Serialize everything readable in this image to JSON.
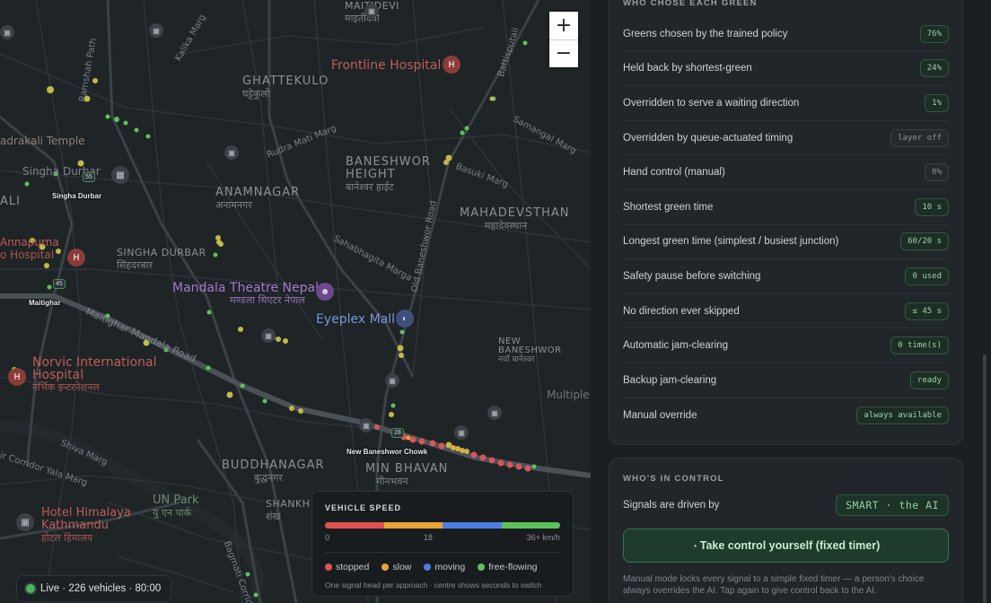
{
  "map": {
    "places": [
      {
        "id": "ghattekulo",
        "name": "GHATTEKULO",
        "local": "घट्टेकुलो"
      },
      {
        "id": "anamnagar",
        "name": "ANAMNAGAR",
        "local": "अनामनगर"
      },
      {
        "id": "baneshwor-height",
        "name": "BANESHWOR HEIGHT",
        "local": "बानेश्वर हाईट"
      },
      {
        "id": "mahadevsthan",
        "name": "MAHADEVSTHAN",
        "local": "महादेवस्थान"
      },
      {
        "id": "singha-durbar",
        "name": "SINGHA DURBAR",
        "local": "सिंहदरबार"
      },
      {
        "id": "buddhanagar",
        "name": "BUDDHANAGAR",
        "local": "बुद्धनगर"
      },
      {
        "id": "min-bhavan",
        "name": "MIN BHAVAN",
        "local": "मीनभवन"
      },
      {
        "id": "new-baneshwor",
        "name": "NEW BANESHWOR",
        "local": "नयाँ बानेश्वर"
      },
      {
        "id": "maitidevi",
        "name": "MAITIDEVI",
        "local": "माइतीदेवी"
      },
      {
        "id": "shankh",
        "name": "SHANKH",
        "local": "शंख"
      }
    ],
    "landmarks": {
      "frontline": "Frontline Hospital",
      "mandala": "Mandala Theatre Nepal",
      "mandala_local": "मण्डला थिएटर नेपाल",
      "eyeplex": "Eyeplex Mall",
      "norvic": "Norvic International Hospital",
      "norvic_local": "नर्भिक इन्टरनेशनल",
      "bhadrakali": "adrakali Temple",
      "singha_durbar_poi": "Singha Durbar",
      "annapurna": "Annapurna",
      "hospital_fragment": "o Hospital",
      "himalaya": "Hotel Himalaya Kathmandu",
      "himalaya_local": "होटल हिमालय",
      "un_park": "UN Park",
      "un_park_local": "यु एन पार्क",
      "multiple": "Multiple"
    },
    "roads": {
      "ramshah": "Ramshah Path",
      "kalika": "Kalika Marg",
      "batisputali": "Battisputali",
      "samangal": "Samangal Marg",
      "rudra": "Rudra Mati Marg",
      "basuki": "Basuki Marg",
      "old_baneshwor": "Old Baneshwor Road",
      "sahabhagita": "Sahabhagita Marga",
      "maitighar_mandala": "Maitighar Mandala Road",
      "shiva": "Shiva Marg",
      "corridor": "ir Corridor Yala Marg",
      "bagmati": "Bagmati Corridor",
      "ali": "ALI"
    },
    "junctions": {
      "singha": {
        "label": "Singha Durbar",
        "seconds": "55"
      },
      "maitighar": {
        "label": "Maitighar",
        "seconds": "45"
      },
      "new_baneshwor": {
        "label": "New Baneshwor Chowk",
        "seconds": "28"
      }
    },
    "zoom_in": "+",
    "zoom_out": "−"
  },
  "speed_legend": {
    "title": "VEHICLE SPEED",
    "ticks": [
      "0",
      "18",
      "36+ km/h"
    ],
    "colors": [
      "#e05252",
      "#e8a63a",
      "#4f7fe0",
      "#5ec25c"
    ],
    "items": [
      {
        "label": "stopped",
        "color": "#e05252"
      },
      {
        "label": "slow",
        "color": "#e8a63a"
      },
      {
        "label": "moving",
        "color": "#4f7fe0"
      },
      {
        "label": "free-flowing",
        "color": "#5ec25c"
      }
    ],
    "note": "One signal head per approach · centre shows seconds to switch"
  },
  "live": "Live · 226 vehicles · 80:00",
  "panel": {
    "greens_title": "WHO CHOSE EACH GREEN",
    "rows": [
      {
        "label": "Greens chosen by the trained policy",
        "value": "76%",
        "state": "on"
      },
      {
        "label": "Held back by shortest-green",
        "value": "24%",
        "state": "on"
      },
      {
        "label": "Overridden to serve a waiting direction",
        "value": "1%",
        "state": "on"
      },
      {
        "label": "Overridden by queue-actuated timing",
        "value": "layer off",
        "state": "off"
      },
      {
        "label": "Hand control (manual)",
        "value": "0%",
        "state": "off"
      },
      {
        "label": "Shortest green time",
        "value": "10 s",
        "state": "on"
      },
      {
        "label": "Longest green time (simplest / busiest junction)",
        "value": "60/20 s",
        "state": "on"
      },
      {
        "label": "Safety pause before switching",
        "value": "0 used",
        "state": "on"
      },
      {
        "label": "No direction ever skipped",
        "value": "≤ 45 s",
        "state": "on"
      },
      {
        "label": "Automatic jam-clearing",
        "value": "0 time(s)",
        "state": "on"
      },
      {
        "label": "Backup jam-clearing",
        "value": "ready",
        "state": "on"
      },
      {
        "label": "Manual override",
        "value": "always available",
        "state": "on"
      }
    ],
    "control_title": "WHO'S IN CONTROL",
    "driven_label": "Signals are driven by",
    "driven_value": "SMART · the AI",
    "take_icon": "◔",
    "take_label": "Take control yourself (fixed timer)",
    "manual_note": "Manual mode locks every signal to a simple fixed timer — a person's choice always overrides the AI. Tap again to give control back to the AI."
  }
}
